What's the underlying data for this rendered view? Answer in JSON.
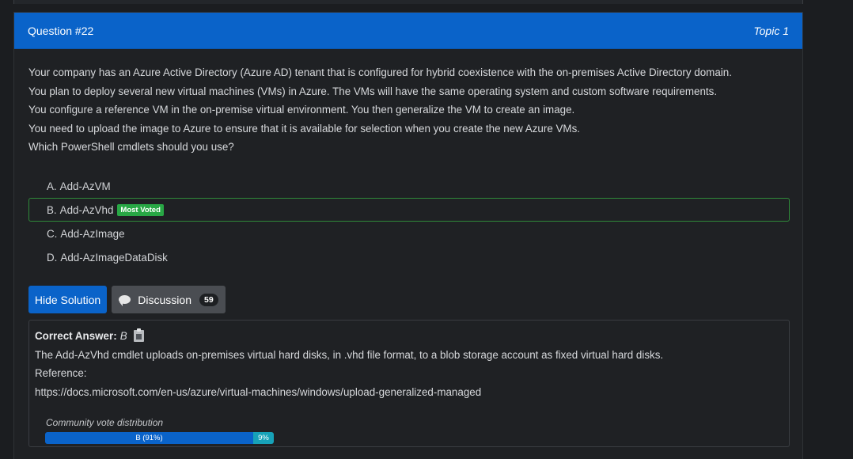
{
  "header": {
    "question_number": "Question #22",
    "topic": "Topic 1"
  },
  "question": {
    "lines": [
      "Your company has an Azure Active Directory (Azure AD) tenant that is configured for hybrid coexistence with the on-premises Active Directory domain.",
      "You plan to deploy several new virtual machines (VMs) in Azure. The VMs will have the same operating system and custom software requirements.",
      "You configure a reference VM in the on-premise virtual environment. You then generalize the VM to create an image.",
      "You need to upload the image to Azure to ensure that it is available for selection when you create the new Azure VMs.",
      "Which PowerShell cmdlets should you use?"
    ]
  },
  "choices": [
    {
      "letter": "A.",
      "text": "Add-AzVM"
    },
    {
      "letter": "B.",
      "text": "Add-AzVhd",
      "badge": "Most Voted"
    },
    {
      "letter": "C.",
      "text": "Add-AzImage"
    },
    {
      "letter": "D.",
      "text": "Add-AzImageDataDisk"
    }
  ],
  "buttons": {
    "hide_solution": "Hide Solution",
    "discussion": "Discussion",
    "discussion_count": "59"
  },
  "answer": {
    "label": "Correct Answer:",
    "value": "B",
    "explanation": "The Add-AzVhd cmdlet uploads on-premises virtual hard disks, in .vhd file format, to a blob storage account as fixed virtual hard disks.",
    "reference_label": "Reference:",
    "reference_url": "https://docs.microsoft.com/en-us/azure/virtual-machines/windows/upload-generalized-managed"
  },
  "vote": {
    "title": "Community vote distribution",
    "segments": [
      {
        "label": "B (91%)",
        "fraction": 0.91,
        "color": "#0a63c9"
      },
      {
        "label": "9%",
        "fraction": 0.09,
        "color": "#17a2b8"
      }
    ]
  },
  "colors": {
    "accent": "#0a63c9",
    "voted_border": "#2f8a3a",
    "badge": "#28a745",
    "background": "#1b1d20"
  },
  "icons": {
    "clipboard": "clipboard-icon",
    "chat": "chat-bubble-icon"
  }
}
